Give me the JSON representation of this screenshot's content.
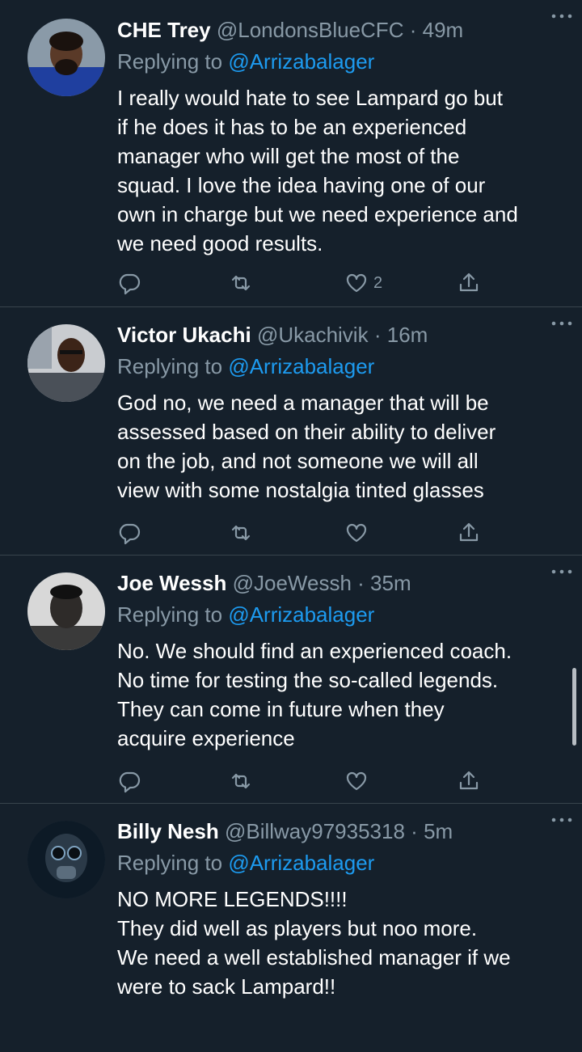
{
  "tweets": [
    {
      "name": "CHE Trey",
      "handle": "@LondonsBlueCFC",
      "separator": "·",
      "time": "49m",
      "replying_prefix": "Replying to",
      "replying_to": "@Arrizabalager",
      "text": "I really would hate to see Lampard go but\nif he does it has to be an experienced\nmanager who will get the most of the\nsquad. I love the idea having one of our\nown in charge but we need experience and\nwe need good results.",
      "likes": "2"
    },
    {
      "name": "Victor Ukachi",
      "handle": "@Ukachivik",
      "separator": "·",
      "time": "16m",
      "replying_prefix": "Replying to",
      "replying_to": "@Arrizabalager",
      "text": "God no, we need a manager that will be\nassessed based on their ability to deliver\non the job, and not someone we will all\nview with some nostalgia tinted glasses",
      "likes": ""
    },
    {
      "name": "Joe Wessh",
      "handle": "@JoeWessh",
      "separator": "·",
      "time": "35m",
      "replying_prefix": "Replying to",
      "replying_to": "@Arrizabalager",
      "text": "No. We should find an experienced coach.\nNo time for testing the so-called legends.\nThey can come in future when they\nacquire experience",
      "likes": ""
    },
    {
      "name": "Billy Nesh",
      "handle": "@Billway97935318",
      "separator": "·",
      "time": "5m",
      "replying_prefix": "Replying to",
      "replying_to": "@Arrizabalager",
      "text": "NO MORE LEGENDS!!!!\nThey did well as players but noo more.\nWe need a well established manager if we\nwere to sack Lampard!!",
      "likes": ""
    }
  ],
  "icons": {
    "reply": "reply-icon",
    "retweet": "retweet-icon",
    "like": "heart-icon",
    "share": "share-icon",
    "more": "more-icon"
  },
  "colors": {
    "background": "#15202b",
    "muted": "#8899a6",
    "link": "#1d9bf0",
    "divider": "#38444d"
  }
}
